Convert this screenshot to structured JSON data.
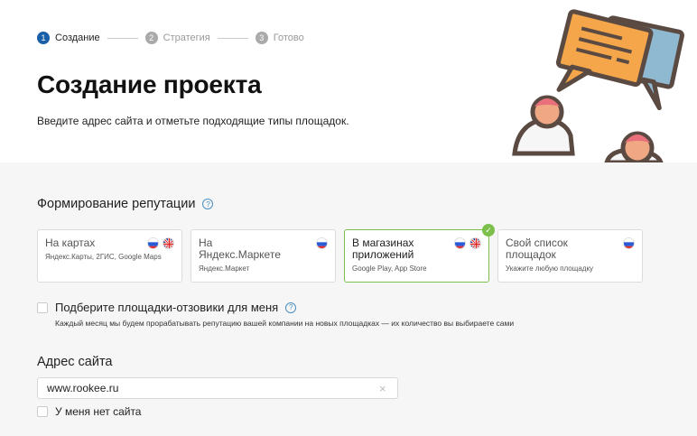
{
  "steps": [
    {
      "num": "1",
      "label": "Создание",
      "state": "active"
    },
    {
      "num": "2",
      "label": "Стратегия",
      "state": "inactive"
    },
    {
      "num": "3",
      "label": "Готово",
      "state": "inactive"
    }
  ],
  "title": "Создание проекта",
  "subtitle": "Введите адрес сайта и отметьте подходящие типы площадок.",
  "reputation": {
    "title": "Формирование репутации",
    "help_icon": "?",
    "cards": [
      {
        "title": "На картах",
        "sub": "Яндекс.Карты, 2ГИС, Google Maps",
        "flags": [
          "ru-flag-icon",
          "uk-flag-icon"
        ],
        "selected": false
      },
      {
        "title": "На Яндекс.Маркете",
        "sub": "Яндекс.Маркет",
        "flags": [
          "ru-flag-icon"
        ],
        "selected": false
      },
      {
        "title": "В магазинах приложений",
        "sub": "Google Play, App Store",
        "flags": [
          "ru-flag-icon",
          "uk-flag-icon"
        ],
        "selected": true
      },
      {
        "title": "Свой список площадок",
        "sub": "Укажите любую площадку",
        "flags": [
          "ru-flag-icon"
        ],
        "selected": false
      }
    ],
    "check_glyph": "✓"
  },
  "pick": {
    "label": "Подберите площадки-отзовики для меня",
    "help_icon": "?",
    "note": "Каждый месяц мы будем прорабатывать репутацию вашей компании на новых площадках — их количество вы выбираете сами"
  },
  "address": {
    "title": "Адрес сайта",
    "value": "www.rookee.ru",
    "clear_glyph": "×",
    "no_site_label": "У меня нет сайта"
  },
  "colors": {
    "accent": "#1a5fa8",
    "selected_border": "#7cc04b",
    "section_bg": "#f6f6f6"
  }
}
